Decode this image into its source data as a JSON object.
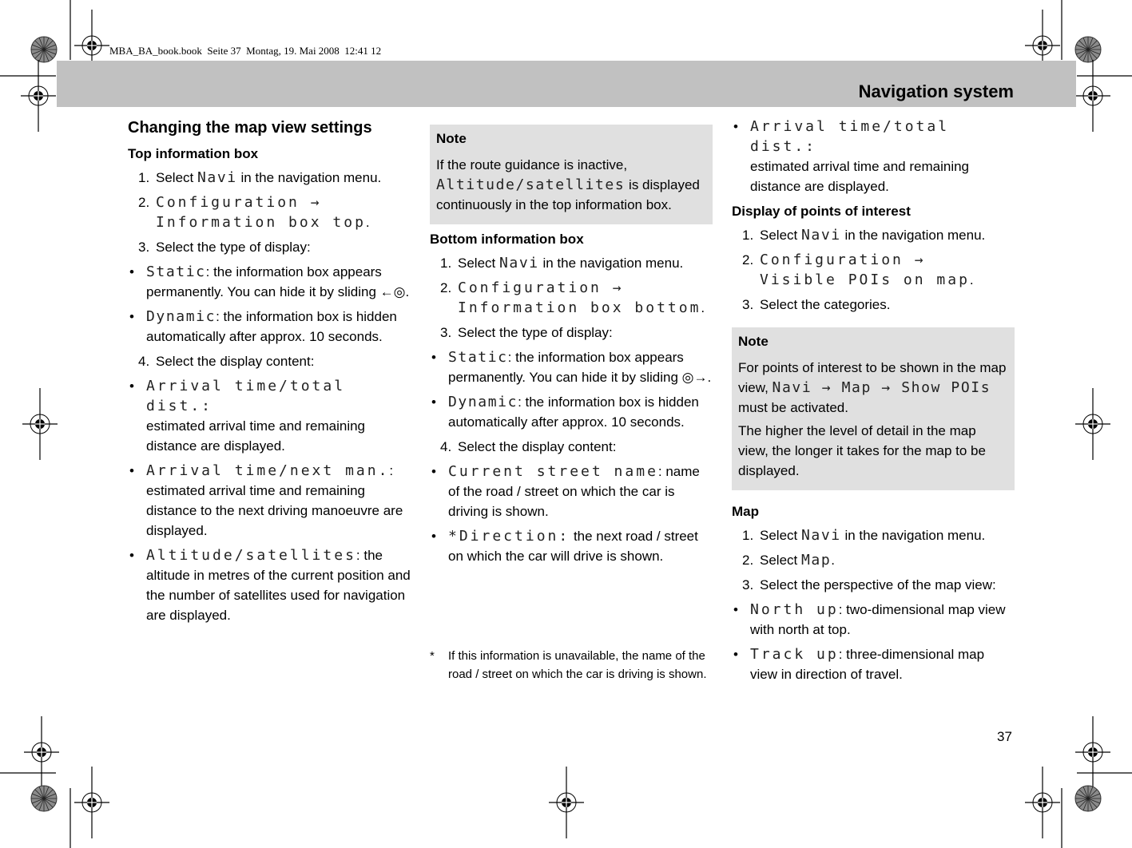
{
  "print_info": "MBA_BA_book.book  Seite 37  Montag, 19. Mai 2008  12:41 12",
  "header": {
    "title": "Navigation system"
  },
  "col1": {
    "section_title": "Changing the map view settings",
    "top_box": {
      "title": "Top information box",
      "steps": [
        {
          "num": "1.",
          "pre": "Select ",
          "code": "Navi",
          "post": " in the navigation menu."
        },
        {
          "num": "2.",
          "code1": "Configuration →",
          "code2": "Information box top",
          "post": "."
        },
        {
          "num": "3.",
          "text": "Select the type of display:"
        },
        {
          "num": "4.",
          "text": "Select the display content:"
        }
      ],
      "type_bullets": [
        {
          "code": "Static",
          "text": ": the information box appears permanently. You can hide it by sliding ",
          "icon": "←◎",
          "end": "."
        },
        {
          "code": "Dynamic",
          "text": ": the information box is hidden automatically after approx. 10 seconds."
        }
      ],
      "content_bullets": [
        {
          "code": "Arrival time/total dist.:",
          "text": "estimated arrival time and remaining distance are displayed."
        },
        {
          "code": "Arrival time/next man.",
          "text": ": estimated arrival time and remaining distance to the next driving manoeuvre are displayed."
        },
        {
          "code": "Altitude/satellites",
          "text": ": the altitude in metres of the current position and the number of satellites used for navigation are displayed."
        }
      ]
    }
  },
  "col2": {
    "note": {
      "title": "Note",
      "pre": "If the route guidance is inactive, ",
      "code": "Altitude/satellites",
      "post": " is displayed continuously in the top information box."
    },
    "bottom_box": {
      "title": "Bottom information box",
      "steps": [
        {
          "num": "1.",
          "pre": "Select ",
          "code": "Navi",
          "post": " in the navigation menu."
        },
        {
          "num": "2.",
          "code1": "Configuration →",
          "code2": "Information box bottom",
          "post": "."
        },
        {
          "num": "3.",
          "text": "Select the type of display:"
        },
        {
          "num": "4.",
          "text": "Select the display content:"
        }
      ],
      "type_bullets": [
        {
          "code": "Static",
          "text": ": the information box appears permanently. You can hide it by sliding ",
          "icon": "◎→",
          "end": "."
        },
        {
          "code": "Dynamic",
          "text": ": the information box is hidden automatically after approx. 10 seconds."
        }
      ],
      "content_bullets": [
        {
          "code": "Current street name",
          "text": ": name of the road / street on which the car is driving is shown."
        },
        {
          "code": "*Direction:",
          "text": " the next road / street on which the car will drive is shown."
        }
      ]
    },
    "footnote": {
      "star": "*",
      "text": "If this information is unavailable, the name of the road / street on which the car is driving is shown."
    }
  },
  "col3": {
    "carry_bullet": {
      "code": "Arrival time/total dist.:",
      "text": "estimated arrival time and remaining distance are displayed."
    },
    "poi": {
      "title": "Display of points of interest",
      "steps": [
        {
          "num": "1.",
          "pre": "Select ",
          "code": "Navi",
          "post": " in the navigation menu."
        },
        {
          "num": "2.",
          "code1": "Configuration →",
          "code2": "Visible POIs on map",
          "post": "."
        },
        {
          "num": "3.",
          "text": "Select the categories."
        }
      ]
    },
    "note": {
      "title": "Note",
      "p1_pre": "For points of interest to be shown in the map view, ",
      "p1_code": "Navi → Map → Show POIs",
      "p1_post": " must be activated.",
      "p2": "The higher the level of detail in the map view, the longer it takes for the map to be displayed."
    },
    "map": {
      "title": "Map",
      "steps": [
        {
          "num": "1.",
          "pre": "Select ",
          "code": "Navi",
          "post": " in the navigation menu."
        },
        {
          "num": "2.",
          "pre": "Select ",
          "code": "Map",
          "post": "."
        },
        {
          "num": "3.",
          "text": "Select the perspective of the map view:"
        }
      ],
      "bullets": [
        {
          "code": "North up",
          "text": ": two-dimensional map view with north at top."
        },
        {
          "code": "Track up",
          "text": ": three-dimensional map view in direction of travel."
        }
      ]
    }
  },
  "page_number": "37",
  "bullet_glyph": "•"
}
